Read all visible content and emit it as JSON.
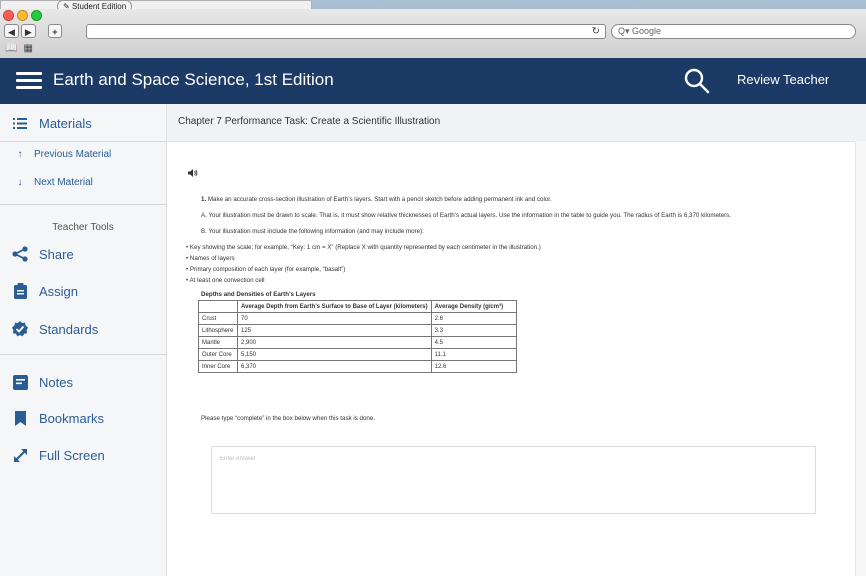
{
  "background_window": {
    "tab_label": "Student Edition"
  },
  "browser": {
    "back": "◀",
    "forward": "▶",
    "new_tab": "+",
    "reload_glyph": "↻",
    "search_placeholder": "Q▾ Google",
    "bookmarks_glyphs": [
      "📖",
      "▦"
    ]
  },
  "header": {
    "title": "Earth and Space Science, 1st Edition",
    "user": "Review Teacher",
    "bg": "#1b3a66"
  },
  "sidebar": {
    "materials": "Materials",
    "previous": "Previous Material",
    "next": "Next Material",
    "tools_label": "Teacher Tools",
    "share": "Share",
    "assign": "Assign",
    "standards": "Standards",
    "notes": "Notes",
    "bookmarks": "Bookmarks",
    "fullscreen": "Full Screen",
    "accent": "#2a5d95"
  },
  "main": {
    "chapter_title": "Chapter 7 Performance Task: Create a Scientific Illustration",
    "q_number": "1.",
    "q_text": " Make an accurate cross-section illustration of Earth’s layers. Start with a pencil sketch before adding permanent ink and color.",
    "a_text": "A. Your illustration must be drawn to scale. That is, it must show relative thicknesses of Earth’s actual layers. Use the information in the table to guide you. The radius of Earth is 6,370 kilometers.",
    "b_text": "B. Your illustration must include the following information (and may include more):",
    "bullets": [
      "Key showing the scale; for example, “Key: 1 cm = X” (Replace X with quantity represented by each centimeter in the illustration.)",
      "Names of layers",
      "Primary composition of each layer (for example, “basalt”)",
      "At least one convection cell"
    ],
    "table_title": "Depths and Densities of Earth’s Layers",
    "table_headers": [
      "",
      "Average Depth from Earth’s Surface to Base of Layer (kilometers)",
      "Average Density (g/cm³)"
    ],
    "table_rows": [
      [
        "Crust",
        "70",
        "2.6"
      ],
      [
        "Lithosphere",
        "125",
        "3.3"
      ],
      [
        "Mantle",
        "2,900",
        "4.5"
      ],
      [
        "Outer Core",
        "5,150",
        "11.1"
      ],
      [
        "Inner Core",
        "6,370",
        "12.6"
      ]
    ],
    "prompt": "Please type “complete” in the box below when this task is done.",
    "answer_placeholder": "Enter Answer"
  }
}
